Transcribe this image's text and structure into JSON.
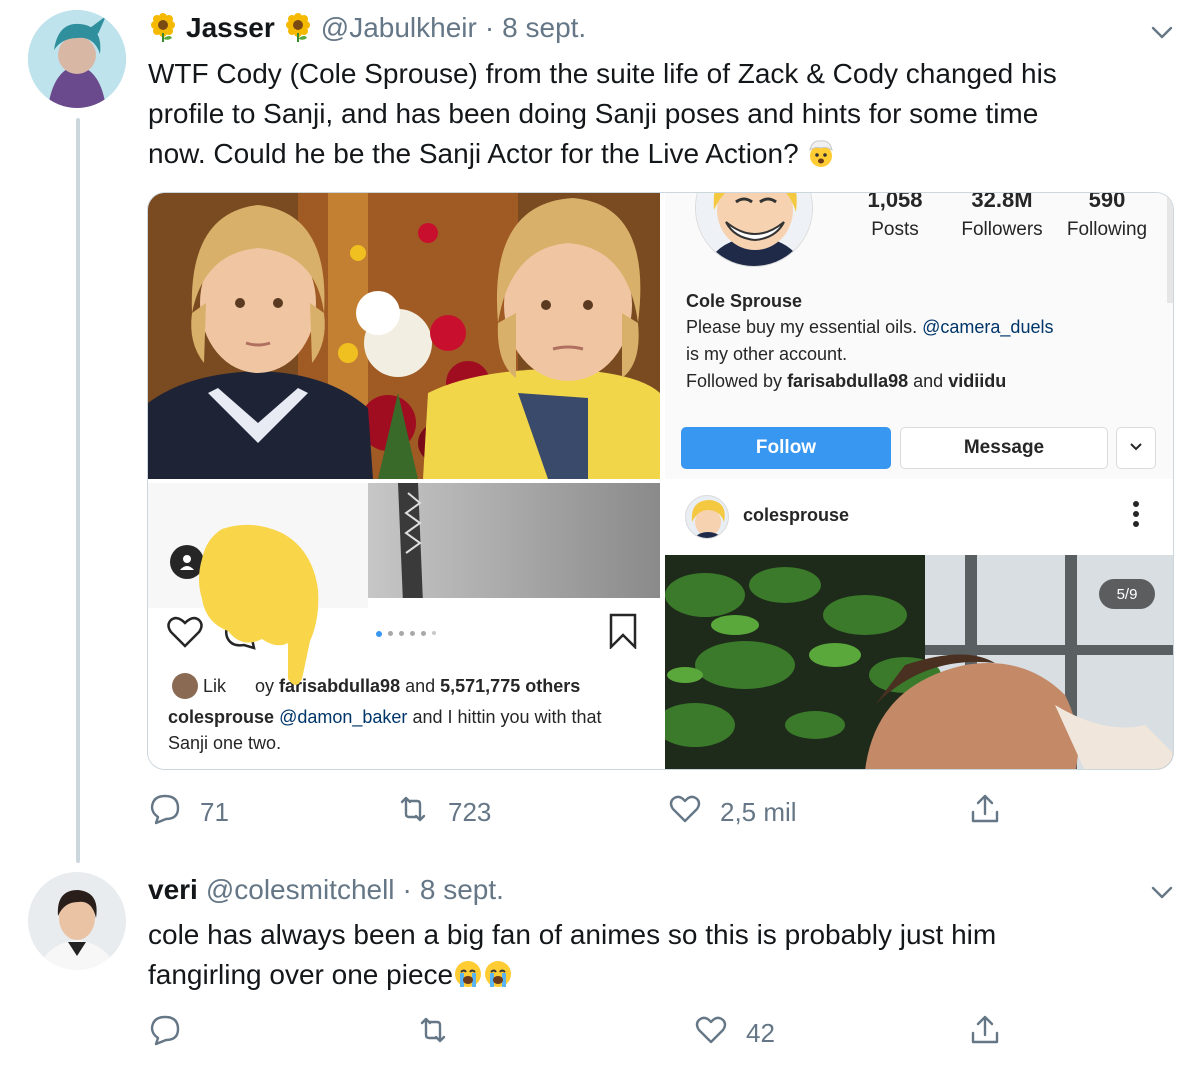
{
  "tweet1": {
    "name": "Jasser",
    "handle": "@Jabulkheir",
    "separator": "·",
    "date": "8 sept.",
    "text_lines": [
      "WTF Cody (Cole Sprouse) from the suite life of Zack & Cody changed his",
      "profile to Sanji, and has been doing Sanji poses and hints for some time",
      "now. Could he be the Sanji Actor for the Live Action?"
    ],
    "actions": {
      "replies": "71",
      "retweets": "723",
      "likes": "2,5 mil"
    }
  },
  "ig_profile": {
    "posts_count": "1,058",
    "posts_label": "Posts",
    "followers_count": "32.8M",
    "followers_label": "Followers",
    "following_count": "590",
    "following_label": "Following",
    "display_name": "Cole Sprouse",
    "bio_line1_text": "Please buy my essential oils.",
    "bio_line1_link": "@camera_duels",
    "bio_line2": "is my other account.",
    "followed_by_prefix": "Followed by",
    "followed_by_user1": "farisabdulla98",
    "followed_by_and": "and",
    "followed_by_user2": "vidiidu",
    "follow_button": "Follow",
    "message_button": "Message"
  },
  "ig_post": {
    "username": "colesprouse",
    "counter": "5/9"
  },
  "ig_caption": {
    "liked_prefix": "Lik",
    "liked_mid": "oy",
    "liked_user": "farisabdulla98",
    "liked_and": "and",
    "liked_others": "5,571,775 others",
    "caption_user": "colesprouse",
    "caption_mention": "@damon_baker",
    "caption_text": "and I hittin you with that",
    "caption_line2": "Sanji one two."
  },
  "tweet2": {
    "name": "veri",
    "handle": "@colesmitchell",
    "separator": "·",
    "date": "8 sept.",
    "text_lines": [
      "cole has always been a big fan of animes so this is probably just him",
      "fangirling over one piece"
    ],
    "actions": {
      "replies": "",
      "retweets": "",
      "likes": "42"
    }
  },
  "colors": {
    "twitter_gray": "#657786",
    "instagram_blue": "#3897f0",
    "thread_line": "#ccd6dd"
  }
}
